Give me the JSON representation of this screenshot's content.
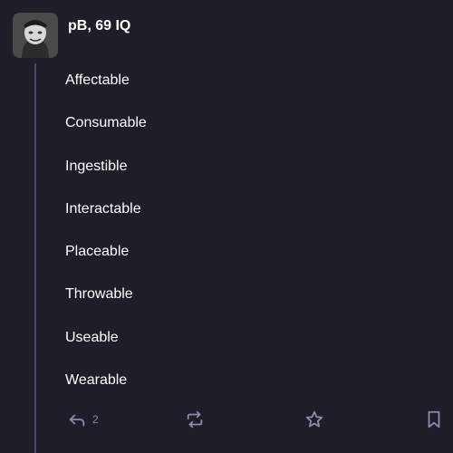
{
  "post": {
    "author": {
      "display_name": "pB, 69 IQ",
      "avatar_icon": "avatar-image"
    },
    "lines": [
      "Affectable",
      "Consumable",
      "Ingestible",
      "Interactable",
      "Placeable",
      "Throwable",
      "Useable",
      "Wearable"
    ],
    "actions": {
      "reply_count": "2",
      "reply_icon": "reply-icon",
      "boost_icon": "boost-icon",
      "favourite_icon": "star-icon",
      "bookmark_icon": "bookmark-icon"
    }
  },
  "colors": {
    "background": "#1e1d28",
    "text": "#ffffff",
    "icon": "#8c8aa8",
    "thread_line": "#4a4860"
  }
}
